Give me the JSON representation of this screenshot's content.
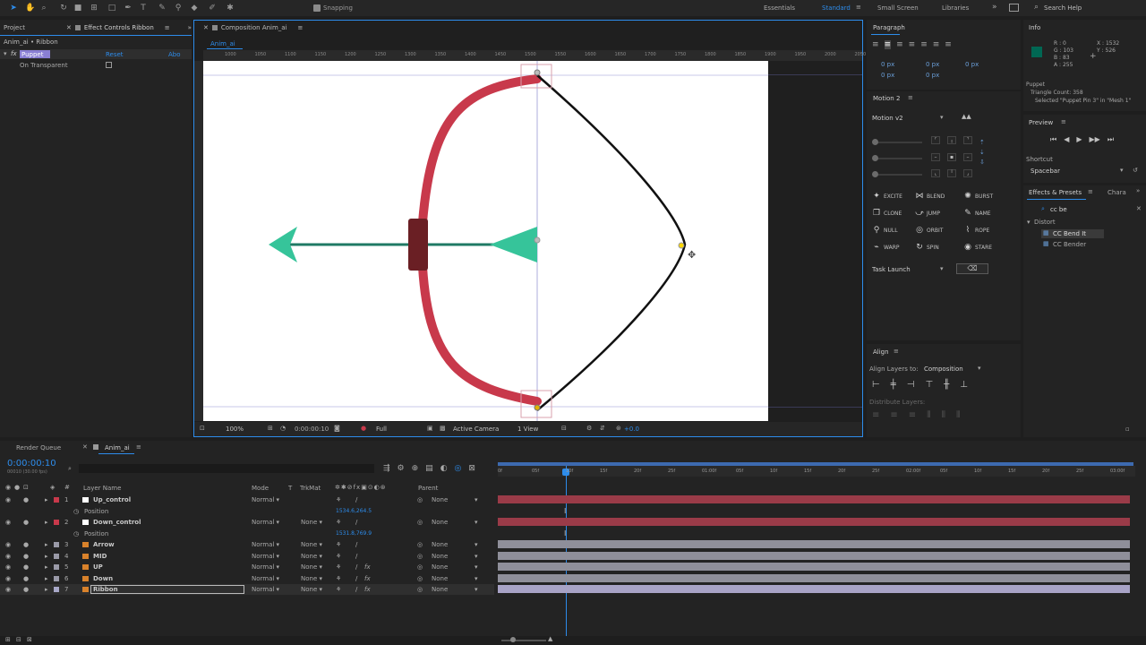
{
  "toolbar": {
    "snapping": "Snapping",
    "workspaces": [
      "Essentials",
      "Standard",
      "Small Screen",
      "Libraries"
    ],
    "search_help": "Search Help"
  },
  "left_panel": {
    "tab_project": "Project",
    "tab_effect_controls": "Effect Controls Ribbon",
    "breadcrumb": "Anim_ai • Ribbon",
    "effect_name": "Puppet",
    "reset": "Reset",
    "about": "Abo",
    "on_transparent": "On Transparent"
  },
  "composition": {
    "tab": "Composition Anim_ai",
    "sub_tab": "Anim_ai",
    "ruler_marks": [
      "1000",
      "1050",
      "1100",
      "1150",
      "1200",
      "1250",
      "1300",
      "1350",
      "1400",
      "1450",
      "1500",
      "1550",
      "1600",
      "1650",
      "1700",
      "1750",
      "1800",
      "1850",
      "1900",
      "1950",
      "2000",
      "2050"
    ],
    "footer": {
      "zoom": "100%",
      "timecode": "0:00:00:10",
      "resolution": "Full",
      "camera": "Active Camera",
      "view": "1 View",
      "exposure": "+0.0"
    }
  },
  "paragraph": {
    "title": "Paragraph",
    "values": [
      "0 px",
      "0 px",
      "0 px",
      "0 px",
      "0 px"
    ]
  },
  "motion": {
    "title": "Motion 2",
    "dropdown": "Motion v2",
    "effects": [
      "EXCITE",
      "BLEND",
      "BURST",
      "CLONE",
      "JUMP",
      "NAME",
      "NULL",
      "ORBIT",
      "ROPE",
      "WARP",
      "SPIN",
      "STARE"
    ],
    "task_launch": "Task Launch"
  },
  "align": {
    "title": "Align",
    "align_layers_to": "Align Layers to:",
    "target": "Composition",
    "distribute": "Distribute Layers:"
  },
  "info": {
    "title": "Info",
    "r": "R : 0",
    "g": "G : 103",
    "b": "B : 83",
    "a": "A : 255",
    "x": "X : 1532",
    "y": "Y : 526",
    "line1": "Puppet",
    "line2": "Triangle Count: 358",
    "line3": "Selected \"Puppet Pin 3\" in \"Mesh 1\""
  },
  "preview": {
    "title": "Preview",
    "shortcut_label": "Shortcut",
    "shortcut": "Spacebar"
  },
  "effects_presets": {
    "title": "Effects & Presets",
    "char_tab": "Chara",
    "search": "cc be",
    "category": "Distort",
    "items": [
      "CC Bend It",
      "CC Bender"
    ]
  },
  "timeline": {
    "render_queue": "Render Queue",
    "tab": "Anim_ai",
    "timecode": "0:00:00:10",
    "timecode_sub": "00010 (30.00 fps)",
    "columns": {
      "layer_name": "Layer Name",
      "mode": "Mode",
      "trkmat": "TrkMat",
      "parent": "Parent"
    },
    "ruler": [
      "0f",
      "05f",
      "10f",
      "15f",
      "20f",
      "25f",
      "01:00f",
      "05f",
      "10f",
      "15f",
      "20f",
      "25f",
      "02:00f",
      "05f",
      "10f",
      "15f",
      "20f",
      "25f",
      "03:00f"
    ],
    "layers": [
      {
        "num": "1",
        "name": "Up_control",
        "mode": "Normal",
        "trkmat": "",
        "parent": "None",
        "color": "#c8394b",
        "prop": "Position",
        "prop_value": "1534.6,264.5"
      },
      {
        "num": "2",
        "name": "Down_control",
        "mode": "Normal",
        "trkmat": "None",
        "parent": "None",
        "color": "#c8394b",
        "prop": "Position",
        "prop_value": "1531.8,769.9"
      },
      {
        "num": "3",
        "name": "Arrow",
        "mode": "Normal",
        "trkmat": "None",
        "parent": "None",
        "color": "#9a9aa8"
      },
      {
        "num": "4",
        "name": "MID",
        "mode": "Normal",
        "trkmat": "None",
        "parent": "None",
        "color": "#9a9aa8"
      },
      {
        "num": "5",
        "name": "UP",
        "mode": "Normal",
        "trkmat": "None",
        "parent": "None",
        "color": "#9a9aa8"
      },
      {
        "num": "6",
        "name": "Down",
        "mode": "Normal",
        "trkmat": "None",
        "parent": "None",
        "color": "#9a9aa8"
      },
      {
        "num": "7",
        "name": "Ribbon",
        "mode": "Normal",
        "trkmat": "None",
        "parent": "None",
        "color": "#a8a8c8"
      }
    ]
  },
  "colors": {
    "accent": "#2d8ceb",
    "bow": "#c8394b",
    "arrow": "#36c49a",
    "grip": "#6a1f24",
    "layer_red": "#c8394b"
  }
}
